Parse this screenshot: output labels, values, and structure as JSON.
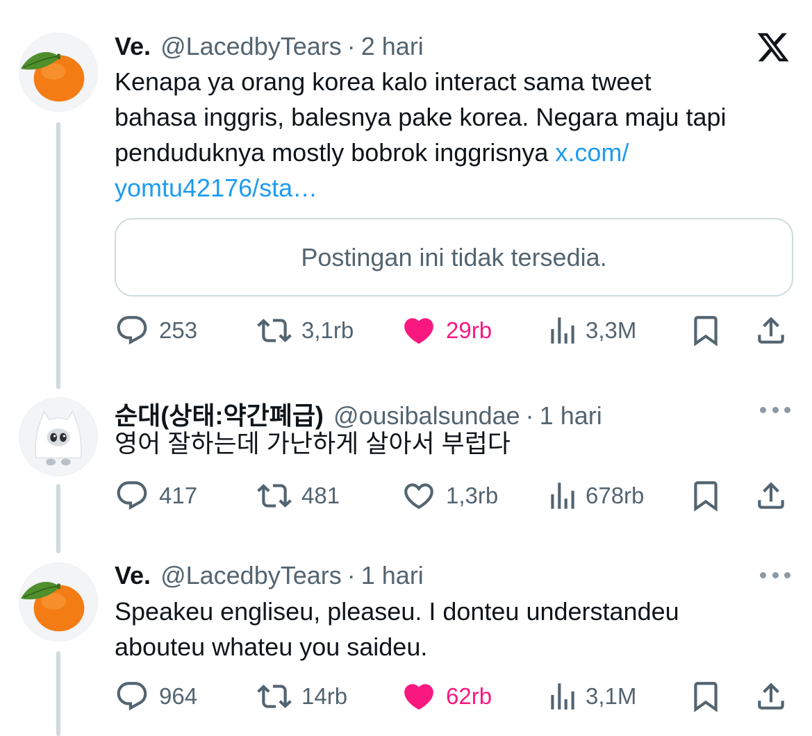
{
  "app": {
    "brand_icon": "x-logo-icon"
  },
  "colors": {
    "link": "#1d9bf0",
    "like": "#f91880",
    "muted": "#536471",
    "thread_line": "#cfd9de"
  },
  "tweets": [
    {
      "avatar_icon": "tangerine-icon",
      "name": "Ve.",
      "handle": "@LacedbyTears",
      "separator": "·",
      "time": "2 hari",
      "text_lines": [
        "Kenapa ya orang korea kalo interact sama tweet",
        "bahasa inggris, balesnya pake korea. Negara maju tapi",
        "penduduknya mostly bobrok inggrisnya "
      ],
      "link_part1": "x.com/",
      "link_part2": "yomtu42176/sta…",
      "quote_unavailable": "Postingan ini tidak tersedia.",
      "stats": {
        "replies": "253",
        "retweets": "3,1rb",
        "likes": "29rb",
        "liked": true,
        "views": "3,3M"
      }
    },
    {
      "avatar_icon": "ghost-character-icon",
      "name": "순대(상태:약간폐급)",
      "handle": "@ousibalsundae",
      "separator": "·",
      "time": "1 hari",
      "text_lines": [
        "영어 잘하는데 가난하게 살아서 부럽다"
      ],
      "stats": {
        "replies": "417",
        "retweets": "481",
        "likes": "1,3rb",
        "liked": false,
        "views": "678rb"
      }
    },
    {
      "avatar_icon": "tangerine-icon",
      "name": "Ve.",
      "handle": "@LacedbyTears",
      "separator": "·",
      "time": "1 hari",
      "text_lines": [
        "Speakeu engliseu, pleaseu. I donteu understandeu",
        "abouteu whateu you saideu."
      ],
      "stats": {
        "replies": "964",
        "retweets": "14rb",
        "likes": "62rb",
        "liked": true,
        "views": "3,1M"
      }
    }
  ]
}
